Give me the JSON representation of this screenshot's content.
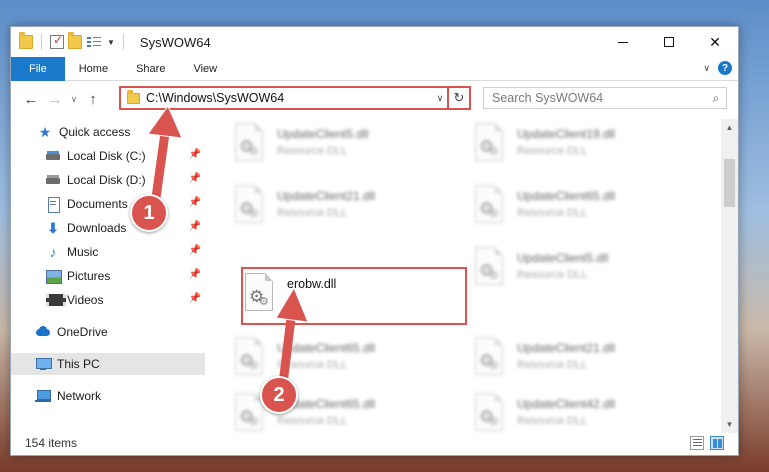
{
  "window": {
    "title": "SysWOW64"
  },
  "ribbon": {
    "tabs": [
      {
        "label": "File"
      },
      {
        "label": "Home"
      },
      {
        "label": "Share"
      },
      {
        "label": "View"
      }
    ],
    "help_label": "?"
  },
  "nav": {
    "address": "C:\\Windows\\SysWOW64",
    "search_placeholder": "Search SysWOW64"
  },
  "sidebar": {
    "items": [
      {
        "label": "Quick access",
        "icon": "star-icon"
      },
      {
        "label": "Local Disk (C:)",
        "icon": "drive-icon"
      },
      {
        "label": "Local Disk (D:)",
        "icon": "drive-icon"
      },
      {
        "label": "Documents",
        "icon": "documents-icon"
      },
      {
        "label": "Downloads",
        "icon": "download-icon"
      },
      {
        "label": "Music",
        "icon": "music-icon"
      },
      {
        "label": "Pictures",
        "icon": "pictures-icon"
      },
      {
        "label": "Videos",
        "icon": "videos-icon"
      },
      {
        "label": "OneDrive",
        "icon": "cloud-icon"
      },
      {
        "label": "This PC",
        "icon": "computer-icon"
      },
      {
        "label": "Network",
        "icon": "network-icon"
      }
    ]
  },
  "files": [
    {
      "name": "UpdateClient5.dll",
      "type": "Resource DLL"
    },
    {
      "name": "UpdateClient19.dll",
      "type": "Resource DLL"
    },
    {
      "name": "UpdateClient21.dll",
      "type": "Resource DLL"
    },
    {
      "name": "UpdateClient65.dll",
      "type": "Resource DLL"
    },
    {
      "name": "erobw.dll",
      "type": ""
    },
    {
      "name": "UpdateClient5.dll",
      "type": "Resource DLL"
    },
    {
      "name": "UpdateClient65.dll",
      "type": "Resource DLL"
    },
    {
      "name": "UpdateClient21.dll",
      "type": "Resource DLL"
    },
    {
      "name": "UpdateClient65.dll",
      "type": "Resource DLL"
    },
    {
      "name": "UpdateClient42.dll",
      "type": "Resource DLL"
    }
  ],
  "status": {
    "item_count": "154 items"
  },
  "callouts": {
    "step1": "1",
    "step2": "2"
  },
  "colors": {
    "accent": "#1979ca",
    "highlight": "#d9534f"
  }
}
